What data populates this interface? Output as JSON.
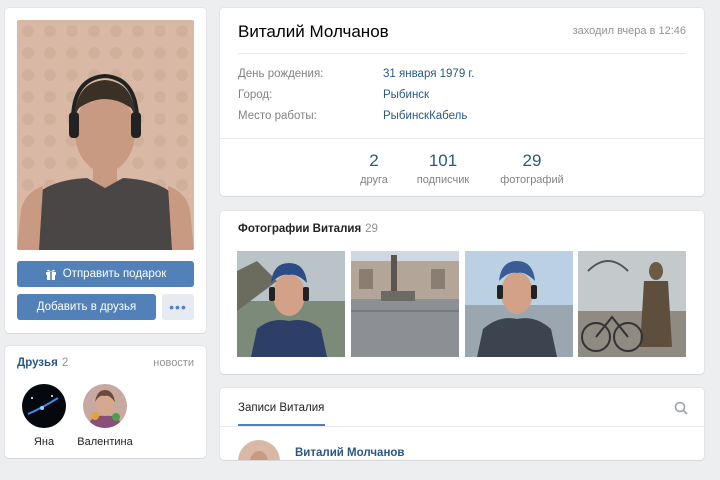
{
  "profile": {
    "name": "Виталий Молчанов",
    "last_seen": "заходил вчера в 12:46",
    "info": [
      {
        "label": "День рождения:",
        "value": "31 января 1979 г."
      },
      {
        "label": "Город:",
        "value": "Рыбинск"
      },
      {
        "label": "Место работы:",
        "value": "РыбинскКабель"
      }
    ],
    "stats": [
      {
        "number": "2",
        "label": "друга"
      },
      {
        "number": "101",
        "label": "подписчик"
      },
      {
        "number": "29",
        "label": "фотографий"
      }
    ]
  },
  "actions": {
    "gift_label": "Отправить подарок",
    "add_friend_label": "Добавить в друзья",
    "more_label": "•••"
  },
  "friends": {
    "title": "Друзья",
    "count": "2",
    "news_link": "новости",
    "list": [
      {
        "name": "Яна"
      },
      {
        "name": "Валентина"
      }
    ]
  },
  "photos": {
    "title": "Фотографии Виталия",
    "count": "29"
  },
  "wall": {
    "tab_label": "Записи Виталия",
    "post_author": "Виталий Молчанов"
  },
  "colors": {
    "accent": "#5181b8",
    "link": "#2a5885",
    "background": "#edeef0"
  },
  "icons": [
    "gift-icon",
    "search-icon",
    "more-icon"
  ]
}
